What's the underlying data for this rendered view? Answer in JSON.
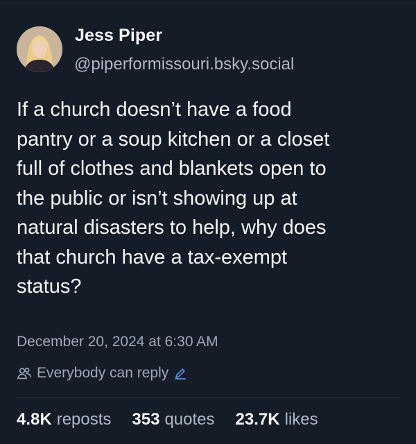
{
  "author": {
    "display_name": "Jess Piper",
    "handle": "@piperformissouri.bsky.social"
  },
  "post": {
    "text": "If a church doesn’t have a food\npantry or a soup kitchen or a closet\nfull of clothes and blankets open to\nthe public or isn’t showing up at\nnatural disasters to help, why does\nthat church have a tax-exempt\nstatus?",
    "timestamp": "December 20, 2024 at 6:30 AM",
    "reply_setting": "Everybody can reply"
  },
  "stats": {
    "reposts_count": "4.8K",
    "reposts_label": "reposts",
    "quotes_count": "353",
    "quotes_label": "quotes",
    "likes_count": "23.7K",
    "likes_label": "likes"
  },
  "icons": {
    "reply_group": "people-icon",
    "edit": "pencil-icon"
  },
  "colors": {
    "background": "#131c27",
    "text": "#f1f3f5",
    "muted": "#9eaab7",
    "accent": "#5a93e6"
  }
}
